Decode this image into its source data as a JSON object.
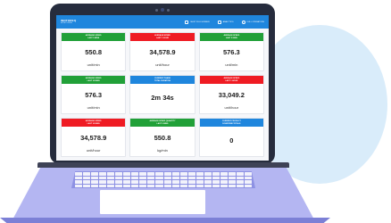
{
  "app": {
    "logo_text": "INNTOREQ",
    "logo_sub": "MONITORING"
  },
  "nav": [
    {
      "label": "SHIFT FULLSCREEN",
      "icon": "fullscreen-icon"
    },
    {
      "label": "ANALYTICS",
      "icon": "analytics-icon"
    },
    {
      "label": "FULL OPERATORS",
      "icon": "operator-icon"
    }
  ],
  "cards": [
    {
      "head1": "AVERAGE SPEED",
      "head2": "LAST 5 MINS",
      "value": "550.8",
      "unit": "unit/min",
      "color": "#21a038"
    },
    {
      "head1": "AVERAGE SPEED",
      "head2": "LAST 1 HOUR",
      "value": "34,578.9",
      "unit": "unit/hour",
      "color": "#ef1b23"
    },
    {
      "head1": "AVERAGE SPEED",
      "head2": "LAST 5 MINS",
      "value": "576.3",
      "unit": "unit/min",
      "color": "#21a038"
    },
    {
      "head1": "AVERAGE SPEED",
      "head2": "LAST 10 MINS",
      "value": "576.3",
      "unit": "unit/min",
      "color": "#21a038"
    },
    {
      "head1": "CURRENT PHASE",
      "head2": "TOTAL DURATION",
      "value": "2m 34s",
      "unit": "",
      "color": "#1f86dd"
    },
    {
      "head1": "AVERAGE SPEED",
      "head2": "LAST 1 HOUR",
      "value": "33,049.2",
      "unit": "unit/hour",
      "color": "#ef1b23"
    },
    {
      "head1": "AVERAGE SPEED",
      "head2": "LAST 10 MINS",
      "value": "34,578.9",
      "unit": "unit/hour",
      "color": "#ef1b23"
    },
    {
      "head1": "AVERAGE SPEED QUANTITY",
      "head2": "LAST 5 MINS",
      "value": "550.8",
      "unit": "kg/min",
      "color": "#21a038"
    },
    {
      "head1": "CURRENT PRODUCT",
      "head2": "DOWNTIME TOTALS",
      "value": "0",
      "unit": "",
      "color": "#1f86dd"
    }
  ]
}
